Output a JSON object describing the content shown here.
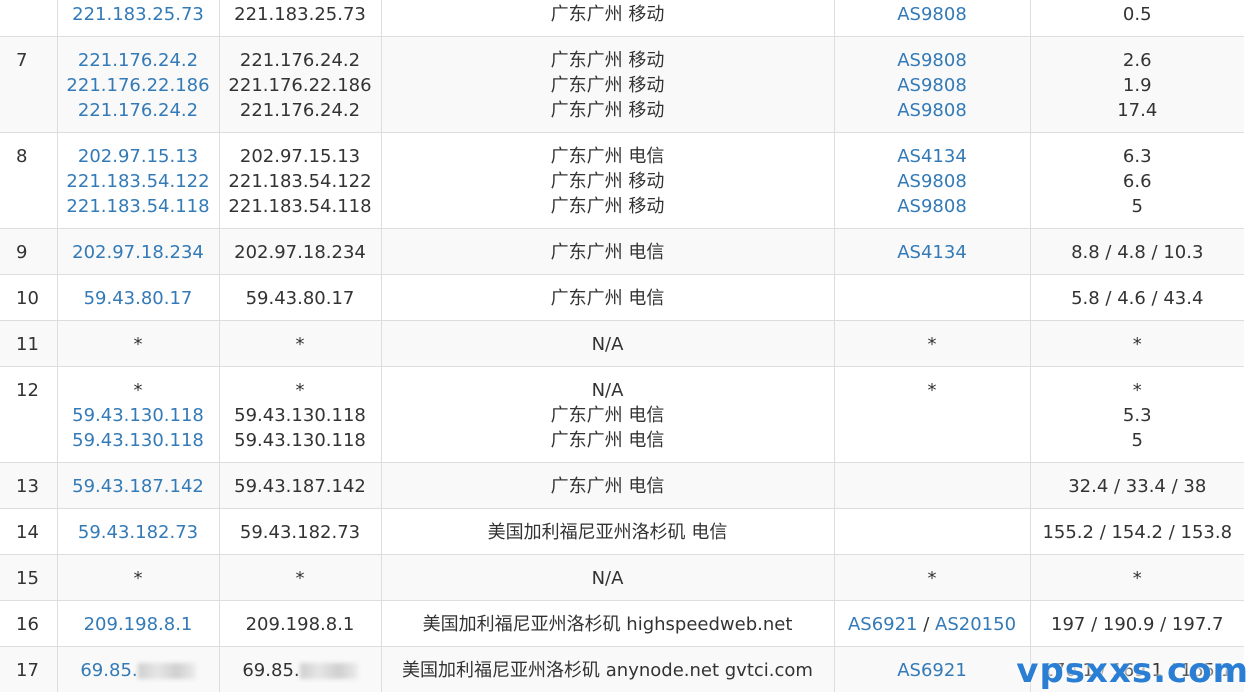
{
  "rows": [
    {
      "hop": "",
      "ips": [
        "221.183.25.73"
      ],
      "hosts": [
        "221.183.25.73"
      ],
      "locations": [
        "广东广州 移动"
      ],
      "as": [
        [
          "AS9808"
        ]
      ],
      "times": [
        "0.5"
      ]
    },
    {
      "hop": "7",
      "ips": [
        "221.176.24.2",
        "221.176.22.186",
        "221.176.24.2"
      ],
      "hosts": [
        "221.176.24.2",
        "221.176.22.186",
        "221.176.24.2"
      ],
      "locations": [
        "广东广州 移动",
        "广东广州 移动",
        "广东广州 移动"
      ],
      "as": [
        [
          "AS9808"
        ],
        [
          "AS9808"
        ],
        [
          "AS9808"
        ]
      ],
      "times": [
        "2.6",
        "1.9",
        "17.4"
      ]
    },
    {
      "hop": "8",
      "ips": [
        "202.97.15.13",
        "221.183.54.122",
        "221.183.54.118"
      ],
      "hosts": [
        "202.97.15.13",
        "221.183.54.122",
        "221.183.54.118"
      ],
      "locations": [
        "广东广州 电信",
        "广东广州 移动",
        "广东广州 移动"
      ],
      "as": [
        [
          "AS4134"
        ],
        [
          "AS9808"
        ],
        [
          "AS9808"
        ]
      ],
      "times": [
        "6.3",
        "6.6",
        "5"
      ]
    },
    {
      "hop": "9",
      "ips": [
        "202.97.18.234"
      ],
      "hosts": [
        "202.97.18.234"
      ],
      "locations": [
        "广东广州 电信"
      ],
      "as": [
        [
          "AS4134"
        ]
      ],
      "times": [
        "8.8 / 4.8 / 10.3"
      ]
    },
    {
      "hop": "10",
      "ips": [
        "59.43.80.17"
      ],
      "hosts": [
        "59.43.80.17"
      ],
      "locations": [
        "广东广州 电信"
      ],
      "as": [
        []
      ],
      "times": [
        "5.8 / 4.6 / 43.4"
      ]
    },
    {
      "hop": "11",
      "ips": [
        "*"
      ],
      "hosts": [
        "*"
      ],
      "locations": [
        "N/A"
      ],
      "as": [
        [
          "*"
        ]
      ],
      "times": [
        "*"
      ]
    },
    {
      "hop": "12",
      "ips": [
        "*",
        "59.43.130.118",
        "59.43.130.118"
      ],
      "hosts": [
        "*",
        "59.43.130.118",
        "59.43.130.118"
      ],
      "locations": [
        "N/A",
        "广东广州 电信",
        "广东广州 电信"
      ],
      "as": [
        [
          "*"
        ],
        [],
        []
      ],
      "times": [
        "*",
        "5.3",
        "5"
      ]
    },
    {
      "hop": "13",
      "ips": [
        "59.43.187.142"
      ],
      "hosts": [
        "59.43.187.142"
      ],
      "locations": [
        "广东广州 电信"
      ],
      "as": [
        []
      ],
      "times": [
        "32.4 / 33.4 / 38"
      ]
    },
    {
      "hop": "14",
      "ips": [
        "59.43.182.73"
      ],
      "hosts": [
        "59.43.182.73"
      ],
      "locations": [
        "美国加利福尼亚州洛杉矶 电信"
      ],
      "as": [
        []
      ],
      "times": [
        "155.2 / 154.2 / 153.8"
      ]
    },
    {
      "hop": "15",
      "ips": [
        "*"
      ],
      "hosts": [
        "*"
      ],
      "locations": [
        "N/A"
      ],
      "as": [
        [
          "*"
        ]
      ],
      "times": [
        "*"
      ]
    },
    {
      "hop": "16",
      "ips": [
        "209.198.8.1"
      ],
      "hosts": [
        "209.198.8.1"
      ],
      "locations": [
        "美国加利福尼亚州洛杉矶 highspeedweb.net"
      ],
      "as": [
        [
          "AS6921",
          "AS20150"
        ]
      ],
      "times": [
        "197 / 190.9 / 197.7"
      ]
    },
    {
      "hop": "17",
      "ips": [
        "69.85."
      ],
      "hosts": [
        "69.85."
      ],
      "locations": [
        "美国加利福尼亚州洛杉矶 anynode.net gvtci.com"
      ],
      "as": [
        [
          "AS6921"
        ]
      ],
      "times": [
        "170.1 / 169.1 / 165.1"
      ]
    }
  ],
  "separator": " / ",
  "watermark": "vpsxxs.com",
  "colors": {
    "link": "#337ab7",
    "text": "#333333",
    "border": "#dddddd",
    "shaded": "#f9f9f9"
  }
}
